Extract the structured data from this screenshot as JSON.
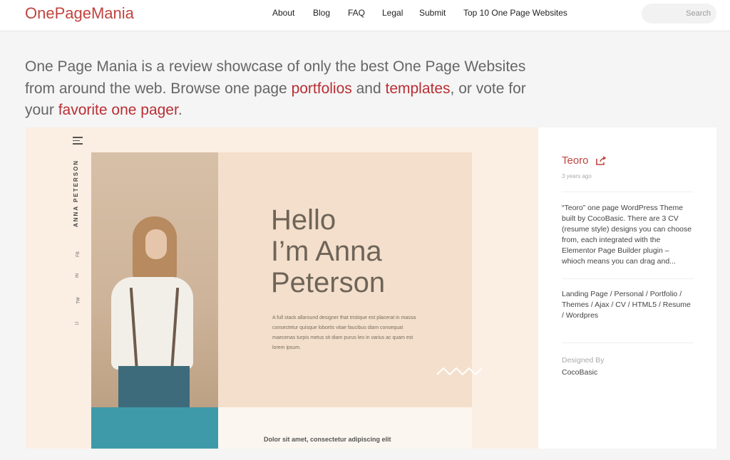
{
  "header": {
    "logo_part1": "One",
    "logo_part2": "PageMania",
    "nav": [
      "About",
      "Blog",
      "FAQ",
      "Legal",
      "Submit",
      "Top 10 One Page Websites"
    ],
    "search_placeholder": "Search"
  },
  "intro": {
    "text1": "One Page Mania is a review showcase of only the best One Page Websites from around the web. Browse one page ",
    "link1": "portfolios",
    "text2": " and ",
    "link2": "templates",
    "text3": ", or vote for your ",
    "link3": "favorite one pager",
    "text4": "."
  },
  "preview": {
    "vertical_name": "ANNA PETERSON",
    "social": [
      "FB",
      "IN",
      "TW",
      "LI"
    ],
    "hello_lines": [
      "Hello",
      "I’m Anna",
      "Peterson"
    ],
    "blurb": "A full stack allaround designer that tristique est placerat in massa consectetur quisque lobortis vitae faucibus diam consequat maecenas turpis metus sit diam purus leo in varius ac quam est lorem ipsum.",
    "bottom_heading": "Dolor sit amet, consectetur adipiscing elit",
    "colors": {
      "background": "#fbeee3",
      "panel": "#f3dfcb",
      "accent": "#3e9aa9"
    }
  },
  "details": {
    "title": "Teoro",
    "time_ago": "3 years ago",
    "description": "“Teoro” one page WordPress Theme built by CocoBasic. There are 3 CV (resume style) designs you can choose from, each integrated with the Elementor Page Builder plugin – whioch means you can drag and...",
    "tags": "Landing Page / Personal / Portfolio / Themes / Ajax / CV / HTML5 / Resume / Wordpres",
    "designed_by_label": "Designed By",
    "designer": "CocoBasic",
    "accent_color": "#c0443f"
  }
}
